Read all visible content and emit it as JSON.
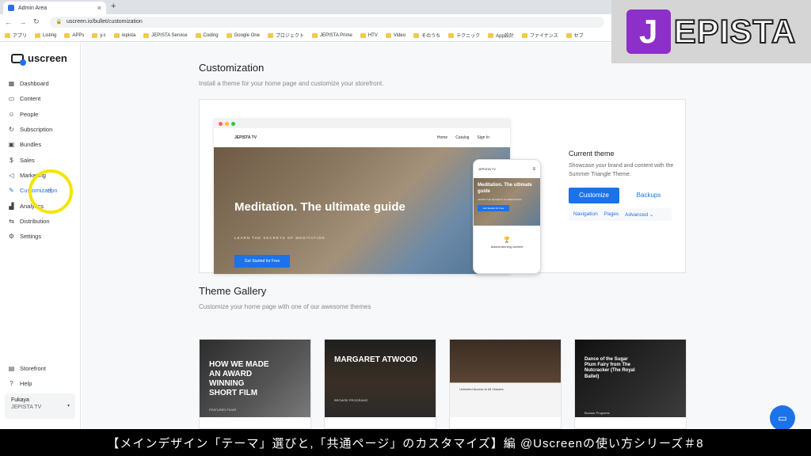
{
  "browser": {
    "tab_title": "Admin Area",
    "url": "uscreen.io/bullet/customization",
    "bookmarks": [
      "アプリ",
      "Listing",
      "APPs",
      "y.c",
      "/epista",
      "JEPISTA Service",
      "Coding",
      "Google One",
      "プロジェクト",
      "JEPISTA Prime",
      "HTV",
      "Video",
      "そのうち",
      "テクニック",
      "App設計",
      "ファイナンス",
      "セブ"
    ]
  },
  "sidebar": {
    "logo": "uscreen",
    "items": [
      {
        "label": "Dashboard",
        "icon": "dashboard-icon",
        "glyph": "▦"
      },
      {
        "label": "Content",
        "icon": "folder-icon",
        "glyph": "▭"
      },
      {
        "label": "People",
        "icon": "people-icon",
        "glyph": "☺"
      },
      {
        "label": "Subscription",
        "icon": "refresh-icon",
        "glyph": "↻"
      },
      {
        "label": "Bundles",
        "icon": "box-icon",
        "glyph": "▣"
      },
      {
        "label": "Sales",
        "icon": "dollar-icon",
        "glyph": "$"
      },
      {
        "label": "Marketing",
        "icon": "megaphone-icon",
        "glyph": "◁"
      },
      {
        "label": "Customization",
        "icon": "edit-icon",
        "glyph": "✎"
      },
      {
        "label": "Analytics",
        "icon": "chart-icon",
        "glyph": "▟"
      },
      {
        "label": "Distribution",
        "icon": "share-icon",
        "glyph": "⇆"
      },
      {
        "label": "Settings",
        "icon": "gear-icon",
        "glyph": "⚙"
      }
    ],
    "bottom_items": [
      {
        "label": "Storefront",
        "icon": "storefront-icon",
        "glyph": "▤"
      },
      {
        "label": "Help",
        "icon": "help-icon",
        "glyph": "?"
      }
    ],
    "account": {
      "name": "Fukaya",
      "org": "JEPISTA TV"
    }
  },
  "main": {
    "title": "Customization",
    "subtitle": "Install a theme for your home page and customize your storefront.",
    "preview": {
      "site_name": "JEPISTA TV",
      "nav_links": [
        "Home",
        "Catalog",
        "Sign In"
      ],
      "hero_title": "Meditation. The ultimate guide",
      "hero_subtitle": "LEARN THE SECRETS OF MEDITATION",
      "hero_button": "Get Started for Free",
      "phone_award": "Award-winning content"
    },
    "current_theme": {
      "title": "Current theme",
      "description": "Showcase your brand and content with the Summer Triangle Theme.",
      "customize_label": "Customize",
      "backups_label": "Backups",
      "links": [
        "Navigation",
        "Pages",
        "Advanced"
      ]
    },
    "gallery_title": "Theme Gallery",
    "gallery_subtitle": "Customize your home page with one of our awesome themes",
    "themes": [
      {
        "title": "HOW WE MADE AN AWARD WINNING SHORT FILM",
        "bottom": "FEATURED FILMS"
      },
      {
        "title": "MARGARET ATWOOD",
        "bottom": "BROWSE PROGRAMS"
      },
      {
        "title": "",
        "bottom": "Unlimited Access to All Classes"
      },
      {
        "title": "Dance of the Sugar Plum Fairy from The Nutcracker (The Royal Ballet)",
        "bottom": "Browse Programs"
      }
    ]
  },
  "overlay": {
    "brand_lead": "J",
    "brand_rest": "EPISTA",
    "caption": "【メインデザイン「テーマ」選びと,「共通ページ」のカスタマイズ】編 @Uscreenの使い方シリーズ＃8"
  },
  "colors": {
    "accent": "#1a73e8",
    "highlight": "#f4e500",
    "brand_purple": "#8d2fc9"
  }
}
